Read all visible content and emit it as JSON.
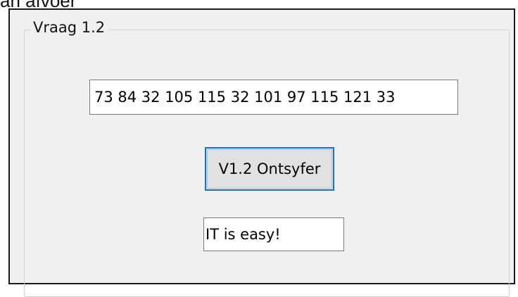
{
  "caption": {
    "text": "an afvoer"
  },
  "group": {
    "title": "Vraag 1.2"
  },
  "input": {
    "value": "73 84 32 105 115 32 101 97 115 121 33"
  },
  "button": {
    "label": "V1.2 Ontsyfer"
  },
  "output": {
    "value": "IT is easy!"
  },
  "colors": {
    "button_focus_border": "#1e6fc8",
    "button_face": "#e1e1e1",
    "window_background": "#f0f0f0"
  }
}
